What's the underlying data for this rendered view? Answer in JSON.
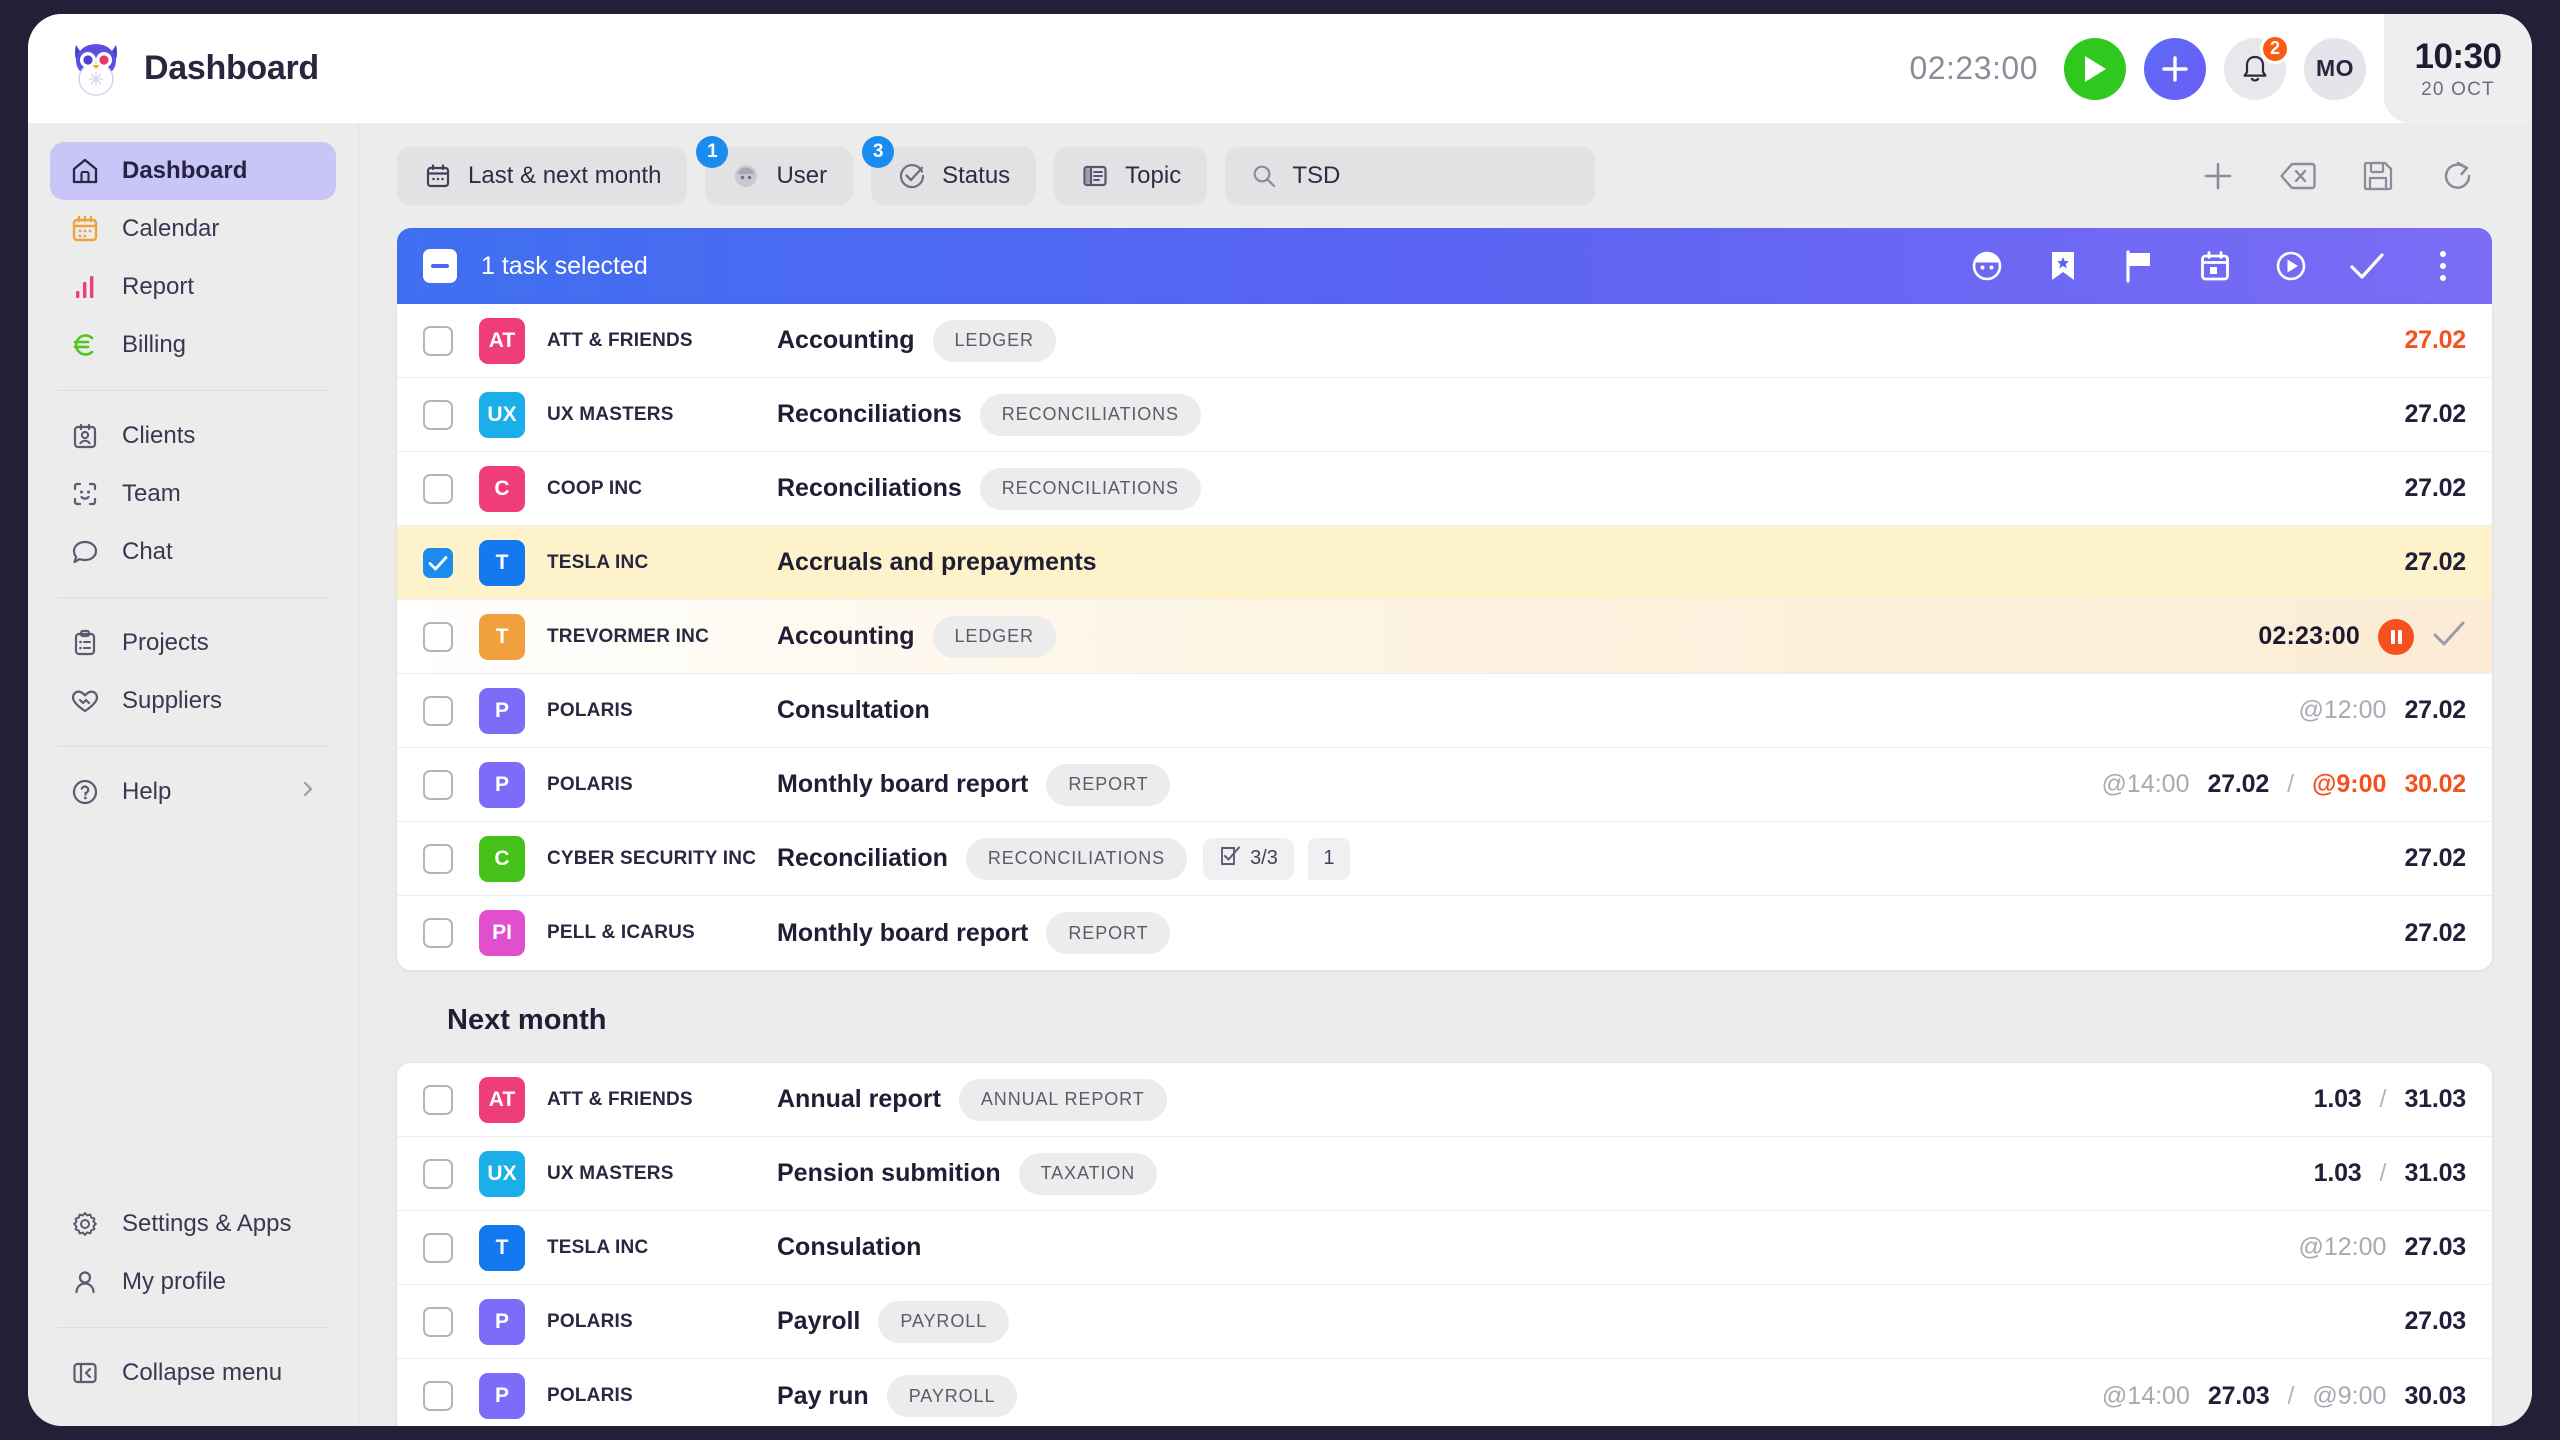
{
  "header": {
    "title": "Dashboard",
    "logo_icon": "owl-logo",
    "timer": "02:23:00",
    "play_icon": "play-icon",
    "add_icon": "plus-icon",
    "bell_icon": "bell-icon",
    "bell_badge": "2",
    "avatar_initials": "MO",
    "clock_time": "10:30",
    "clock_date": "20 OCT"
  },
  "sidebar": {
    "groups": [
      {
        "items": [
          {
            "label": "Dashboard",
            "icon": "home-icon",
            "active": true
          },
          {
            "label": "Calendar",
            "icon": "calendar-icon",
            "active": false
          },
          {
            "label": "Report",
            "icon": "bar-chart-icon",
            "active": false
          },
          {
            "label": "Billing",
            "icon": "euro-icon",
            "active": false
          }
        ]
      },
      {
        "items": [
          {
            "label": "Clients",
            "icon": "contact-card-icon",
            "active": false
          },
          {
            "label": "Team",
            "icon": "face-id-icon",
            "active": false
          },
          {
            "label": "Chat",
            "icon": "chat-bubble-icon",
            "active": false
          }
        ]
      },
      {
        "items": [
          {
            "label": "Projects",
            "icon": "clipboard-icon",
            "active": false
          },
          {
            "label": "Suppliers",
            "icon": "handshake-heart-icon",
            "active": false
          }
        ]
      },
      {
        "items": [
          {
            "label": "Help",
            "icon": "question-circle-icon",
            "active": false,
            "chevron": true
          }
        ]
      }
    ],
    "bottom": [
      {
        "label": "Settings & Apps",
        "icon": "gear-icon"
      },
      {
        "label": "My profile",
        "icon": "person-icon"
      }
    ],
    "collapse": {
      "label": "Collapse menu",
      "icon": "collapse-panel-icon"
    }
  },
  "filters": {
    "chips": [
      {
        "label": "Last & next month",
        "icon": "calendar-icon",
        "badge": null
      },
      {
        "label": "User",
        "icon": "user-avatar-icon",
        "badge": "1"
      },
      {
        "label": "Status",
        "icon": "check-circle-icon",
        "badge": "3"
      },
      {
        "label": "Topic",
        "icon": "book-icon",
        "badge": null
      }
    ],
    "search": {
      "icon": "search-icon",
      "value": "TSD",
      "placeholder": "Search"
    },
    "tools": [
      {
        "icon": "plus-icon",
        "name": "add-task-button"
      },
      {
        "icon": "backspace-clear-icon",
        "name": "clear-filters-button"
      },
      {
        "icon": "save-icon",
        "name": "save-view-button"
      },
      {
        "icon": "refresh-icon",
        "name": "refresh-button"
      }
    ]
  },
  "selection_bar": {
    "checkbox_icon": "indeterminate-checkbox",
    "label": "1 task selected",
    "actions": [
      {
        "icon": "assign-user-icon",
        "name": "assign-user-action"
      },
      {
        "icon": "bookmark-star-icon",
        "name": "bookmark-action"
      },
      {
        "icon": "flag-icon",
        "name": "flag-action"
      },
      {
        "icon": "calendar-icon",
        "name": "schedule-action"
      },
      {
        "icon": "play-circle-icon",
        "name": "start-timer-action"
      },
      {
        "icon": "check-icon",
        "name": "complete-action"
      },
      {
        "icon": "more-vertical-icon",
        "name": "more-actions"
      }
    ]
  },
  "groups": [
    {
      "title": null,
      "rows": [
        {
          "selected": false,
          "state": "normal",
          "initials": "AT",
          "color": "#ef3d77",
          "client": "ATT & FRIENDS",
          "task": "Accounting",
          "tags": [
            "LEDGER"
          ],
          "due": "27.02",
          "due_red": true
        },
        {
          "selected": false,
          "state": "normal",
          "initials": "UX",
          "color": "#1aafe8",
          "client": "UX MASTERS",
          "task": "Reconciliations",
          "tags": [
            "RECONCILIATIONS"
          ],
          "due": "27.02",
          "due_red": false
        },
        {
          "selected": false,
          "state": "normal",
          "initials": "C",
          "color": "#ef3d77",
          "client": "COOP INC",
          "task": "Reconciliations",
          "tags": [
            "RECONCILIATIONS"
          ],
          "due": "27.02",
          "due_red": false
        },
        {
          "selected": true,
          "state": "selected",
          "initials": "T",
          "color": "#1478ef",
          "client": "TESLA INC",
          "task": "Accruals and prepayments",
          "tags": [],
          "due": "27.02",
          "due_red": false
        },
        {
          "selected": false,
          "state": "running",
          "initials": "T",
          "color": "#f0a03c",
          "client": "TREVORMER INC",
          "task": "Accounting",
          "tags": [
            "LEDGER"
          ],
          "timer": "02:23:00",
          "pause_icon": "pause-icon",
          "check_icon": "check-icon"
        },
        {
          "selected": false,
          "state": "normal",
          "initials": "P",
          "color": "#7c6cf7",
          "client": "POLARIS",
          "task": "Consultation",
          "tags": [],
          "at": "@12:00",
          "due": "27.02",
          "due_red": false
        },
        {
          "selected": false,
          "state": "normal",
          "initials": "P",
          "color": "#7c6cf7",
          "client": "POLARIS",
          "task": "Monthly board report",
          "tags": [
            "REPORT"
          ],
          "at": "@14:00",
          "due": "27.02",
          "due_red": false,
          "separator": "/",
          "at2": "@9:00",
          "due2": "30.02",
          "due2_red": true
        },
        {
          "selected": false,
          "state": "normal",
          "initials": "C",
          "color": "#45c21a",
          "client": "CYBER SECURITY INC",
          "task": "Reconciliation",
          "tags": [
            "RECONCILIATIONS"
          ],
          "subtasks": "3/3",
          "subtasks_icon": "checklist-icon",
          "comments": "1",
          "due": "27.02",
          "due_red": false
        },
        {
          "selected": false,
          "state": "normal",
          "initials": "PI",
          "color": "#e04fce",
          "client": "PELL & ICARUS",
          "task": "Monthly board report",
          "tags": [
            "REPORT"
          ],
          "due": "27.02",
          "due_red": false
        }
      ]
    },
    {
      "title": "Next month",
      "rows": [
        {
          "selected": false,
          "state": "normal",
          "initials": "AT",
          "color": "#ef3d77",
          "client": "ATT & FRIENDS",
          "task": "Annual report",
          "tags": [
            "ANNUAL REPORT"
          ],
          "due": "1.03",
          "separator": "/",
          "due2": "31.03"
        },
        {
          "selected": false,
          "state": "normal",
          "initials": "UX",
          "color": "#1aafe8",
          "client": "UX MASTERS",
          "task": "Pension submition",
          "tags": [
            "TAXATION"
          ],
          "due": "1.03",
          "separator": "/",
          "due2": "31.03"
        },
        {
          "selected": false,
          "state": "normal",
          "initials": "T",
          "color": "#1478ef",
          "client": "TESLA INC",
          "task": "Consulation",
          "tags": [],
          "at": "@12:00",
          "due": "27.03"
        },
        {
          "selected": false,
          "state": "normal",
          "initials": "P",
          "color": "#7c6cf7",
          "client": "POLARIS",
          "task": "Payroll",
          "tags": [
            "PAYROLL"
          ],
          "due": "27.03"
        },
        {
          "selected": false,
          "state": "normal",
          "initials": "P",
          "color": "#7c6cf7",
          "client": "POLARIS",
          "task": "Pay run",
          "tags": [
            "PAYROLL"
          ],
          "at": "@14:00",
          "due": "27.03",
          "separator": "/",
          "at2": "@9:00",
          "due2": "30.03"
        }
      ]
    }
  ],
  "colors": {
    "accent_blue": "#4a63f0",
    "selected_row": "#fdf2c9",
    "overdue": "#f4511e",
    "sidebar_active": "#c9c5f7"
  }
}
